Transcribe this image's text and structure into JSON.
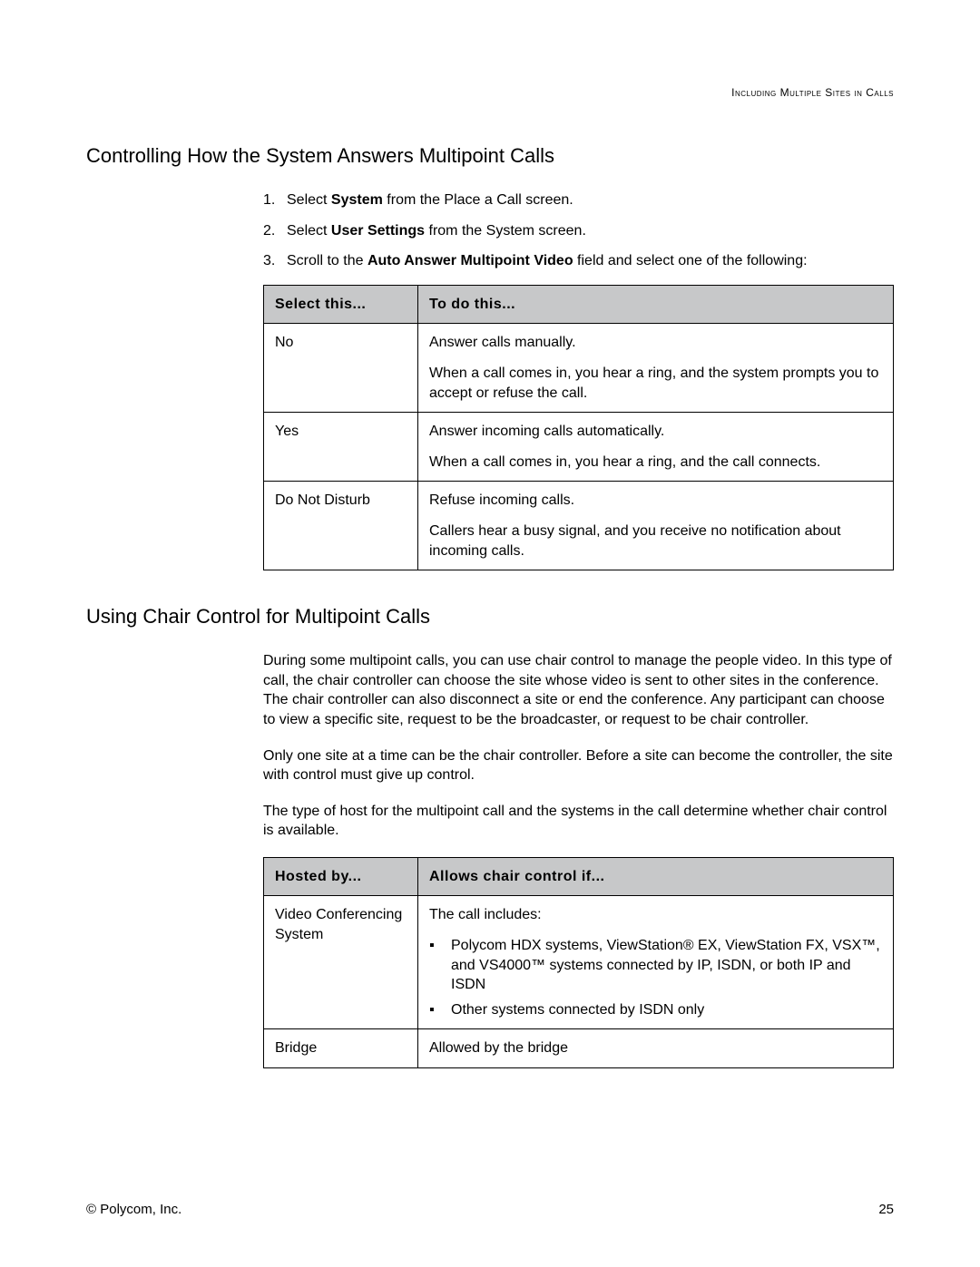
{
  "running_head": "Including Multiple Sites in Calls",
  "heading1": "Controlling How the System Answers Multipoint Calls",
  "steps": [
    {
      "num": "1.",
      "pre": "Select ",
      "bold": "System",
      "post": " from the Place a Call screen."
    },
    {
      "num": "2.",
      "pre": "Select ",
      "bold": "User Settings",
      "post": " from the System screen."
    },
    {
      "num": "3.",
      "pre": "Scroll to the ",
      "bold": "Auto Answer Multipoint Video",
      "post": " field and select one of the following:"
    }
  ],
  "table1": {
    "head": {
      "c1": "Select this...",
      "c2": "To do this..."
    },
    "rows": [
      {
        "c1": "No",
        "lead": "Answer calls manually.",
        "body": "When a call comes in, you hear a ring, and the system prompts you to accept or refuse the call."
      },
      {
        "c1": "Yes",
        "lead": "Answer incoming calls automatically.",
        "body": "When a call comes in, you hear a ring, and the call connects."
      },
      {
        "c1": "Do Not Disturb",
        "lead": "Refuse incoming calls.",
        "body": "Callers hear a busy signal, and you receive no notification about incoming calls."
      }
    ]
  },
  "heading2": "Using Chair Control for Multipoint Calls",
  "para1": "During some multipoint calls, you can use chair control to manage the people video. In this type of call, the chair controller can choose the site whose video is sent to other sites in the conference. The chair controller can also disconnect a site or end the conference. Any participant can choose to view a specific site, request to be the broadcaster, or request to be chair controller.",
  "para2": "Only one site at a time can be the chair controller. Before a site can become the controller, the site with control must give up control.",
  "para3": "The type of host for the multipoint call and the systems in the call determine whether chair control is available.",
  "table2": {
    "head": {
      "c1": "Hosted by...",
      "c2": "Allows chair control if..."
    },
    "row1": {
      "c1": "Video Conferencing System",
      "lead": "The call includes:",
      "bullets": [
        "Polycom HDX systems, ViewStation® EX, ViewStation FX, VSX™, and VS4000™ systems connected by IP, ISDN, or both IP and ISDN",
        "Other systems connected by ISDN only"
      ]
    },
    "row2": {
      "c1": "Bridge",
      "c2": "Allowed by the bridge"
    }
  },
  "footer_left": "© Polycom, Inc.",
  "footer_right": "25"
}
